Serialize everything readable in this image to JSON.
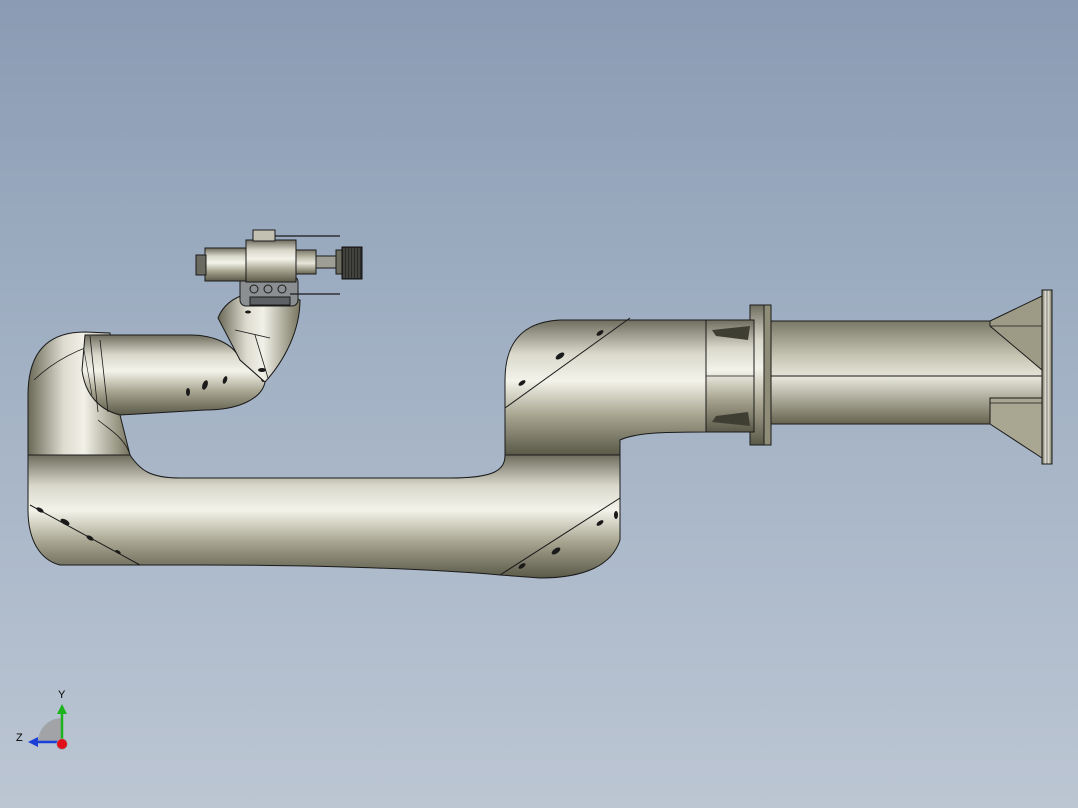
{
  "viewport": {
    "background_top": "#8a9bb3",
    "background_bottom": "#bcc6d3"
  },
  "model": {
    "body_color": "#b4b29c",
    "edge_color": "#1a1a1a"
  },
  "triad": {
    "y_label": "Y",
    "z_label": "Z",
    "y_color": "#1db31d",
    "z_color": "#1a3fd6",
    "x_color": "#e0101a"
  }
}
